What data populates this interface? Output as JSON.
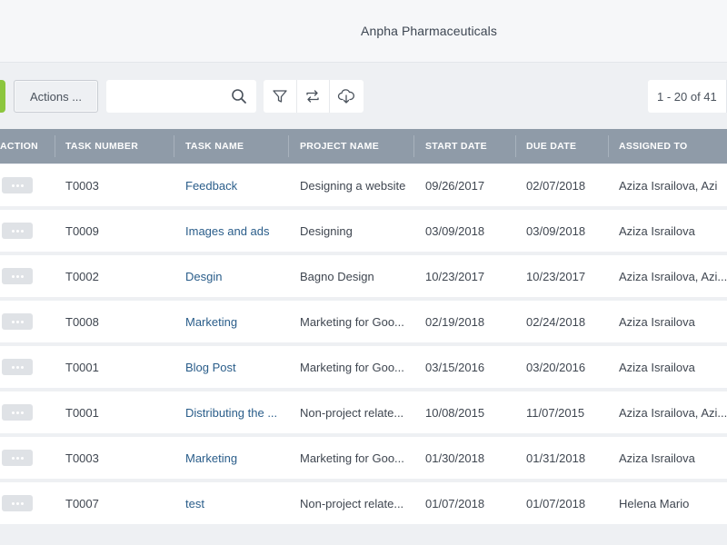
{
  "header": {
    "company": "Anpha Pharmaceuticals"
  },
  "toolbar": {
    "actions_label": "Actions ...",
    "search_value": "",
    "search_placeholder": "",
    "pagination": "1 - 20 of 41"
  },
  "icons": {
    "search": "search-icon",
    "filter": "filter-icon",
    "refresh": "refresh-icon",
    "download": "cloud-download-icon",
    "more": "more-dots-icon"
  },
  "colors": {
    "accent_green": "#8cc63e",
    "table_header": "#8f9ba8",
    "link": "#2a5d8a",
    "background": "#eef0f3"
  },
  "table": {
    "columns": [
      "ACTION",
      "TASK NUMBER",
      "TASK NAME",
      "PROJECT NAME",
      "START DATE",
      "DUE DATE",
      "ASSIGNED TO"
    ],
    "rows": [
      {
        "task_number": "T0003",
        "task_name": "Feedback",
        "project_name": "Designing a website",
        "start_date": "09/26/2017",
        "due_date": "02/07/2018",
        "assigned_to": "Aziza Israilova, Azi"
      },
      {
        "task_number": "T0009",
        "task_name": "Images and ads",
        "project_name": "Designing",
        "start_date": "03/09/2018",
        "due_date": "03/09/2018",
        "assigned_to": "Aziza Israilova"
      },
      {
        "task_number": "T0002",
        "task_name": "Desgin",
        "project_name": "Bagno Design",
        "start_date": "10/23/2017",
        "due_date": "10/23/2017",
        "assigned_to": "Aziza Israilova, Azi..."
      },
      {
        "task_number": "T0008",
        "task_name": "Marketing",
        "project_name": "Marketing for Goo...",
        "start_date": "02/19/2018",
        "due_date": "02/24/2018",
        "assigned_to": "Aziza Israilova"
      },
      {
        "task_number": "T0001",
        "task_name": "Blog Post",
        "project_name": "Marketing for Goo...",
        "start_date": "03/15/2016",
        "due_date": "03/20/2016",
        "assigned_to": "Aziza Israilova"
      },
      {
        "task_number": "T0001",
        "task_name": "Distributing the ...",
        "project_name": "Non-project relate...",
        "start_date": "10/08/2015",
        "due_date": "11/07/2015",
        "assigned_to": "Aziza Israilova, Azi..."
      },
      {
        "task_number": "T0003",
        "task_name": "Marketing",
        "project_name": "Marketing for Goo...",
        "start_date": "01/30/2018",
        "due_date": "01/31/2018",
        "assigned_to": "Aziza Israilova"
      },
      {
        "task_number": "T0007",
        "task_name": "test",
        "project_name": "Non-project relate...",
        "start_date": "01/07/2018",
        "due_date": "01/07/2018",
        "assigned_to": "Helena Mario"
      }
    ]
  }
}
